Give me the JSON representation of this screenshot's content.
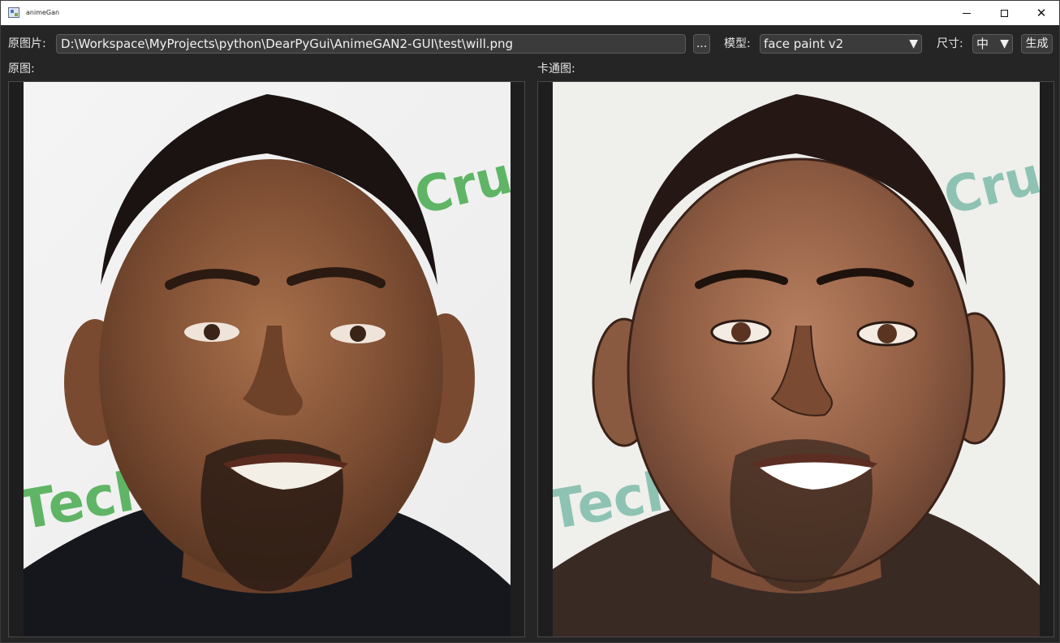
{
  "window": {
    "title": "animeGan",
    "icon": "app-window-icon",
    "controls": {
      "minimize": "minimize-icon",
      "maximize": "maximize-icon",
      "close": "close-icon"
    }
  },
  "toolbar": {
    "source_label": "原图片:",
    "source_path": "D:\\Workspace\\MyProjects\\python\\DearPyGui\\AnimeGAN2-GUI\\test\\will.png",
    "browse_label": "...",
    "model_label": "模型:",
    "model_value": "face paint v2",
    "size_label": "尺寸:",
    "size_value": "中",
    "dropdown_arrow": "▼",
    "generate_label": "生成"
  },
  "panels": {
    "original_label": "原图:",
    "cartoon_label": "卡通图:",
    "original_watermark_top": "Cru",
    "original_watermark_bottom": "Tech",
    "cartoon_watermark_top": "Cru",
    "cartoon_watermark_bottom": "Tech"
  },
  "colors": {
    "background": "#252526",
    "field": "#3b3b3c",
    "text": "#e6e6e6",
    "watermark_original": "#5fb565",
    "watermark_cartoon": "#8ec3b3"
  }
}
